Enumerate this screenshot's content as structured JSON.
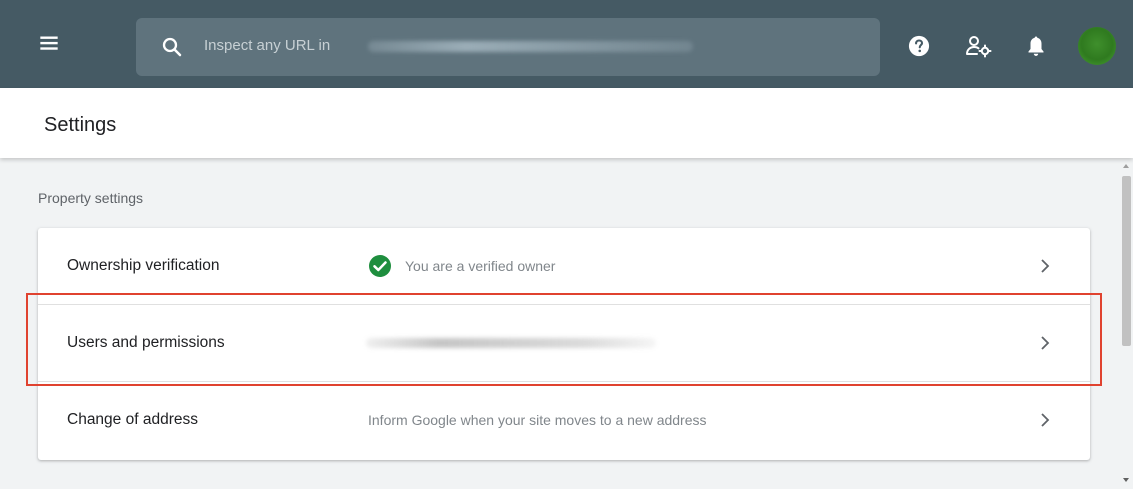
{
  "topbar": {
    "menu_icon": "hamburger-menu-icon",
    "search": {
      "icon": "search-icon",
      "placeholder": "Inspect any URL in"
    },
    "actions": {
      "help_icon": "help-circle-icon",
      "admin_icon": "manage-users-icon",
      "notifications_icon": "bell-icon",
      "avatar_color": "#3f8f2c"
    }
  },
  "header": {
    "title": "Settings"
  },
  "property_settings": {
    "section_label": "Property settings",
    "rows": [
      {
        "label": "Ownership verification",
        "status_icon": "check-circle-icon",
        "status_color": "#1e8e3e",
        "value": "You are a verified owner"
      },
      {
        "label": "Users and permissions",
        "value": ""
      },
      {
        "label": "Change of address",
        "value": "Inform Google when your site moves to a new address"
      }
    ]
  },
  "colors": {
    "topbar": "#455a64",
    "search_box": "#5f737d",
    "highlight": "#e0422f"
  }
}
